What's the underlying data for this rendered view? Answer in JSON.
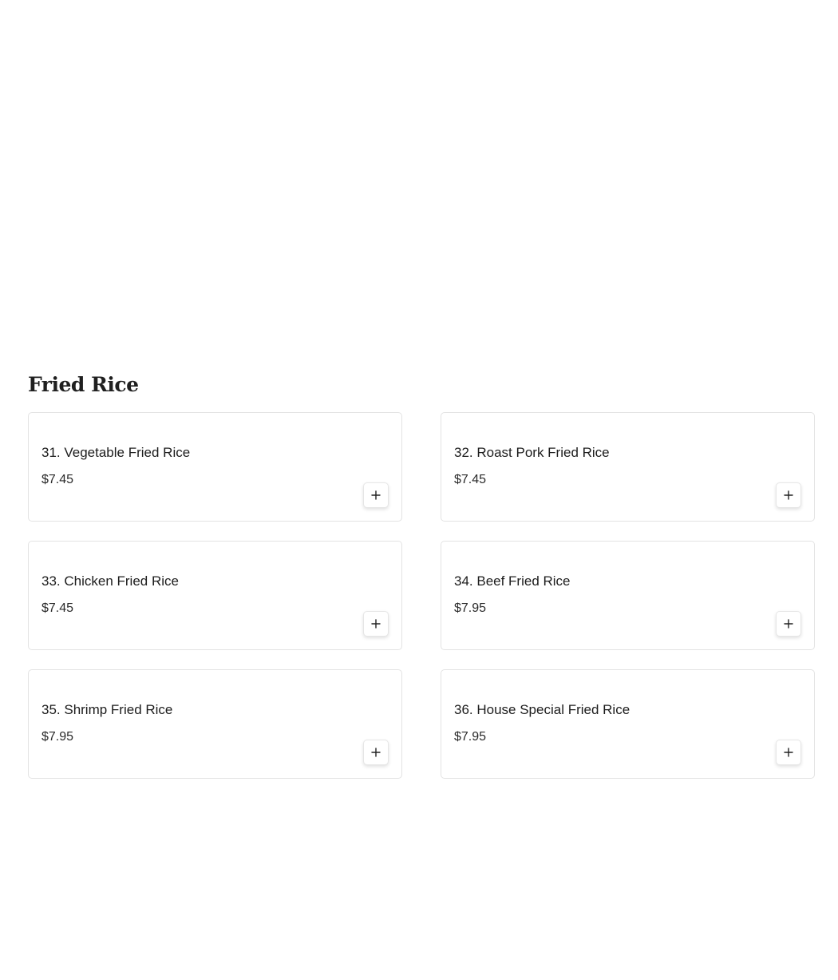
{
  "section": {
    "title": "Fried Rice"
  },
  "items": [
    {
      "name": "31. Vegetable Fried Rice",
      "price": "$7.45",
      "add_icon": "plus-icon"
    },
    {
      "name": "32. Roast Pork Fried Rice",
      "price": "$7.45",
      "add_icon": "plus-icon"
    },
    {
      "name": "33. Chicken Fried Rice",
      "price": "$7.45",
      "add_icon": "plus-icon"
    },
    {
      "name": "34. Beef Fried Rice",
      "price": "$7.95",
      "add_icon": "plus-icon"
    },
    {
      "name": "35. Shrimp Fried Rice",
      "price": "$7.95",
      "add_icon": "plus-icon"
    },
    {
      "name": "36. House Special Fried Rice",
      "price": "$7.95",
      "add_icon": "plus-icon"
    }
  ]
}
